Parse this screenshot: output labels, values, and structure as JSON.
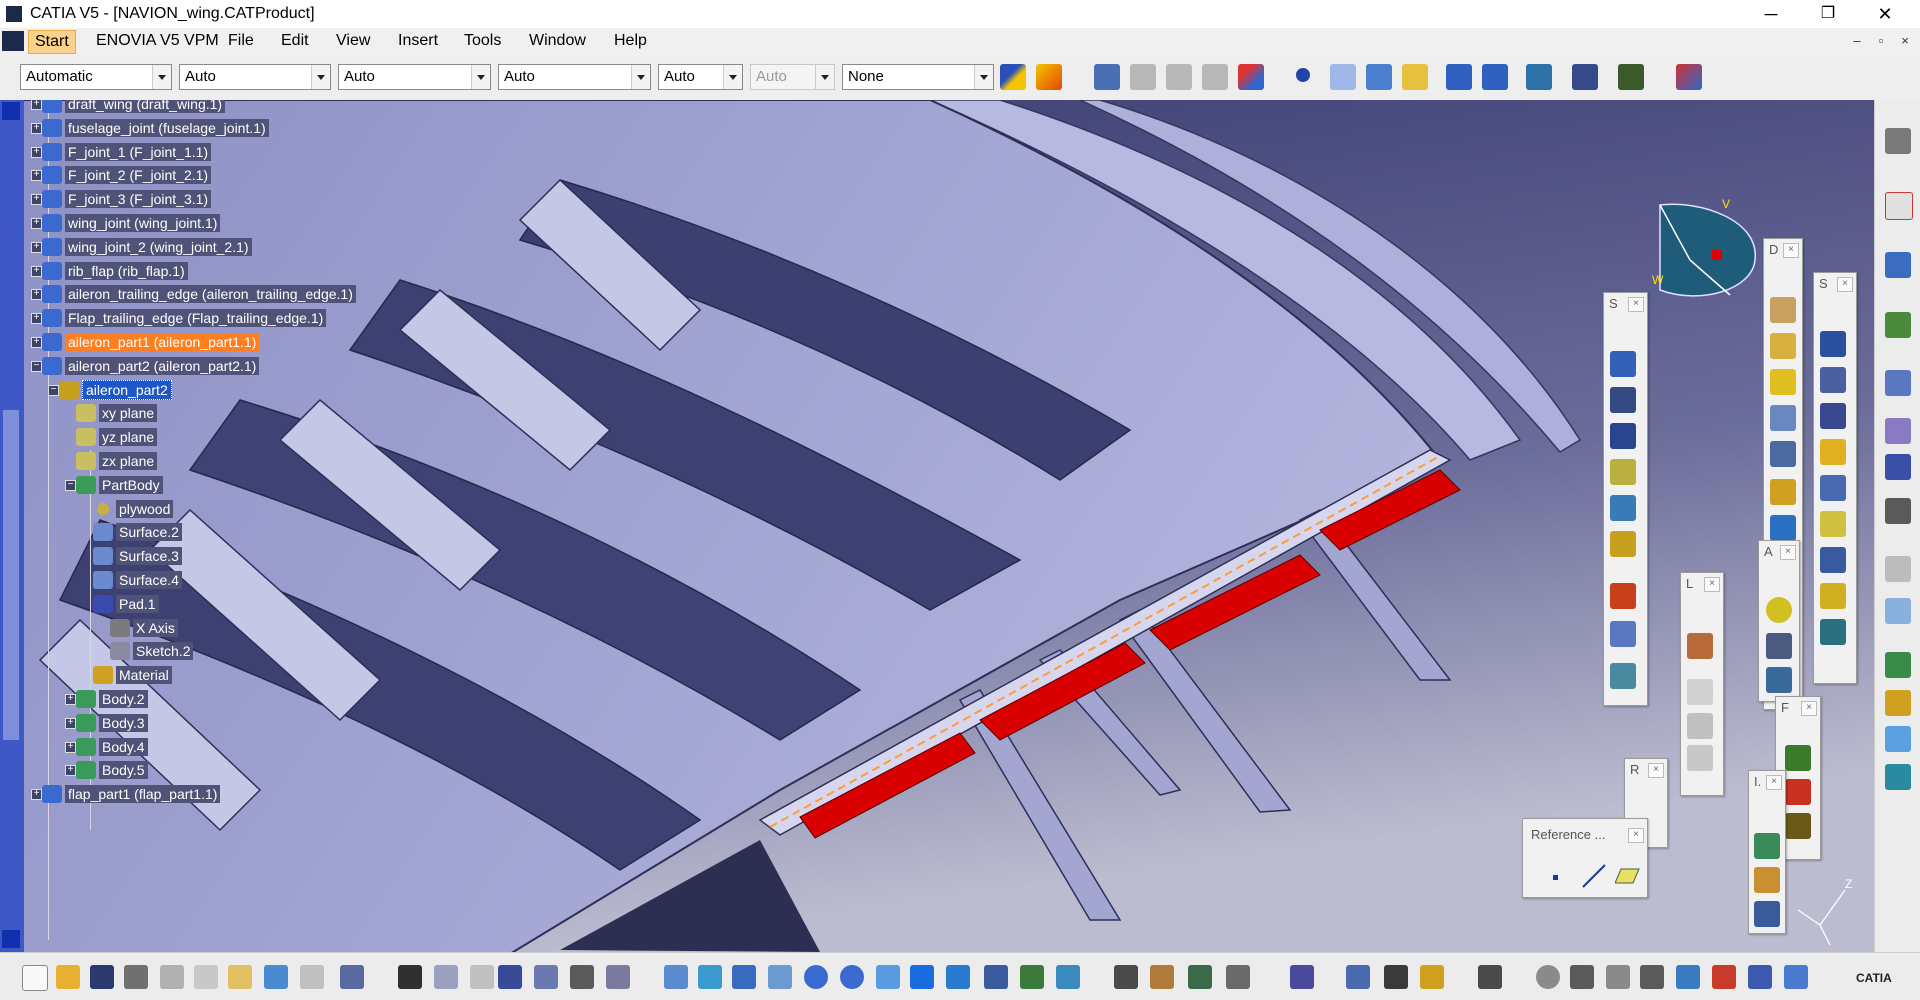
{
  "window": {
    "title": "CATIA V5 - [NAVION_wing.CATProduct]",
    "minimize_glyph": "─",
    "maximize_glyph": "❐",
    "close_glyph": "✕"
  },
  "menubar": {
    "items": [
      "Start",
      "ENOVIA V5 VPM",
      "File",
      "Edit",
      "View",
      "Insert",
      "Tools",
      "Window",
      "Help"
    ],
    "mdi_minimize": "–",
    "mdi_restore": "▫",
    "mdi_close": "×"
  },
  "toolbar": {
    "combos": [
      {
        "value": "Automatic",
        "disabled": false
      },
      {
        "value": "Auto",
        "disabled": false
      },
      {
        "value": "Auto",
        "disabled": false
      },
      {
        "value": "Auto",
        "disabled": false
      },
      {
        "value": "Auto",
        "disabled": false
      },
      {
        "value": "Auto",
        "disabled": true
      },
      {
        "value": "None",
        "disabled": false
      }
    ]
  },
  "tree": {
    "items": [
      {
        "label": "draft_wing (draft_wing.1)",
        "icon": "product-icon"
      },
      {
        "label": "fuselage_joint (fuselage_joint.1)",
        "icon": "product-icon"
      },
      {
        "label": "F_joint_1 (F_joint_1.1)",
        "icon": "product-icon"
      },
      {
        "label": "F_joint_2 (F_joint_2.1)",
        "icon": "product-icon"
      },
      {
        "label": "F_joint_3 (F_joint_3.1)",
        "icon": "product-icon"
      },
      {
        "label": "wing_joint (wing_joint.1)",
        "icon": "product-icon"
      },
      {
        "label": "wing_joint_2 (wing_joint_2.1)",
        "icon": "product-icon"
      },
      {
        "label": "rib_flap (rib_flap.1)",
        "icon": "product-icon"
      },
      {
        "label": "aileron_trailing_edge (aileron_trailing_edge.1)",
        "icon": "product-icon"
      },
      {
        "label": "Flap_trailing_edge (Flap_trailing_edge.1)",
        "icon": "product-icon"
      },
      {
        "label": "aileron_part1 (aileron_part1.1)",
        "icon": "product-icon"
      },
      {
        "label": "aileron_part2 (aileron_part2.1)",
        "icon": "product-icon"
      },
      {
        "label": "aileron_part2",
        "icon": "part-icon"
      },
      {
        "label": "xy plane",
        "icon": "plane-icon"
      },
      {
        "label": "yz plane",
        "icon": "plane-icon"
      },
      {
        "label": "zx plane",
        "icon": "plane-icon"
      },
      {
        "label": "PartBody",
        "icon": "body-icon"
      },
      {
        "label": "plywood",
        "icon": "material-dot-icon"
      },
      {
        "label": "Surface.2",
        "icon": "surface-icon"
      },
      {
        "label": "Surface.3",
        "icon": "surface-icon"
      },
      {
        "label": "Surface.4",
        "icon": "surface-icon"
      },
      {
        "label": "Pad.1",
        "icon": "pad-icon"
      },
      {
        "label": "X Axis",
        "icon": "axis-icon"
      },
      {
        "label": "Sketch.2",
        "icon": "sketch-icon"
      },
      {
        "label": "Material",
        "icon": "material-icon"
      },
      {
        "label": "Body.2",
        "icon": "body-icon"
      },
      {
        "label": "Body.3",
        "icon": "body-icon"
      },
      {
        "label": "Body.4",
        "icon": "body-icon"
      },
      {
        "label": "Body.5",
        "icon": "body-icon"
      },
      {
        "label": "flap_part1 (flap_part1.1)",
        "icon": "product-icon"
      }
    ]
  },
  "floating_toolbars": [
    {
      "title": "S"
    },
    {
      "title": "D"
    },
    {
      "title": "S"
    },
    {
      "title": "A"
    },
    {
      "title": "L"
    },
    {
      "title": "R"
    },
    {
      "title": "F"
    },
    {
      "title": "I."
    },
    {
      "title": "Reference ..."
    }
  ],
  "compass": {
    "v_label": "V",
    "w_label": "W"
  },
  "axis_label": "Z",
  "brand": "CATIA",
  "colors": {
    "viewport_top": "#3b3d72",
    "viewport_bottom": "#b8b8cc",
    "part_light": "#a5a7d4",
    "part_dark": "#3e4275",
    "part_highlight": "#e00000",
    "tree_label_bg": "#4f5377",
    "selection_orange": "#ff7e1f",
    "selection_blue": "#1f57c9"
  }
}
